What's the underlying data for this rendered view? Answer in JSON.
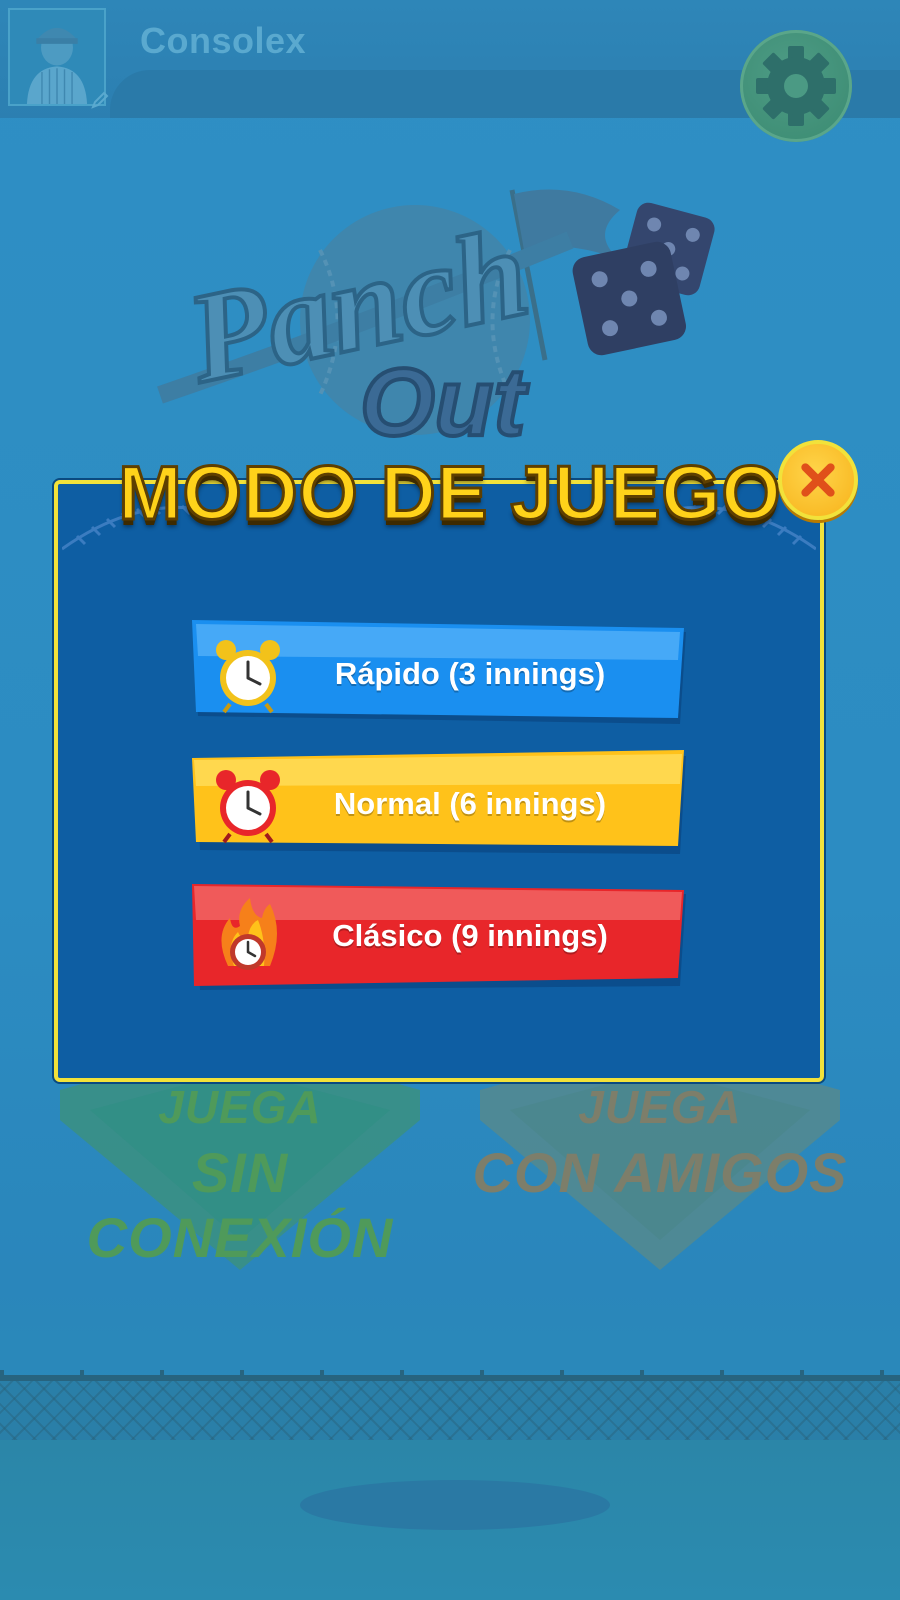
{
  "header": {
    "username": "Consolex"
  },
  "logo": {
    "line1": "Panch",
    "line2": "Out"
  },
  "background_cards": [
    {
      "top": "JUEGA",
      "bottom": "SIN CONEXIÓN"
    },
    {
      "top": "JUEGA",
      "bottom": "CON AMIGOS"
    }
  ],
  "modal": {
    "title": "MODO DE JUEGO",
    "options": [
      {
        "label": "Rápido (3 innings)",
        "color": "#1a8ff0",
        "icon": "alarm-clock-icon"
      },
      {
        "label": "Normal (6 innings)",
        "color": "#ffc21a",
        "icon": "alarm-clock-icon"
      },
      {
        "label": "Clásico (9 innings)",
        "color": "#e8262a",
        "icon": "flaming-clock-icon"
      }
    ]
  },
  "colors": {
    "modal_bg": "#0e5ea3",
    "modal_border": "#f2e23a",
    "title": "#ffd21a",
    "close_button": "#f7b21a"
  }
}
